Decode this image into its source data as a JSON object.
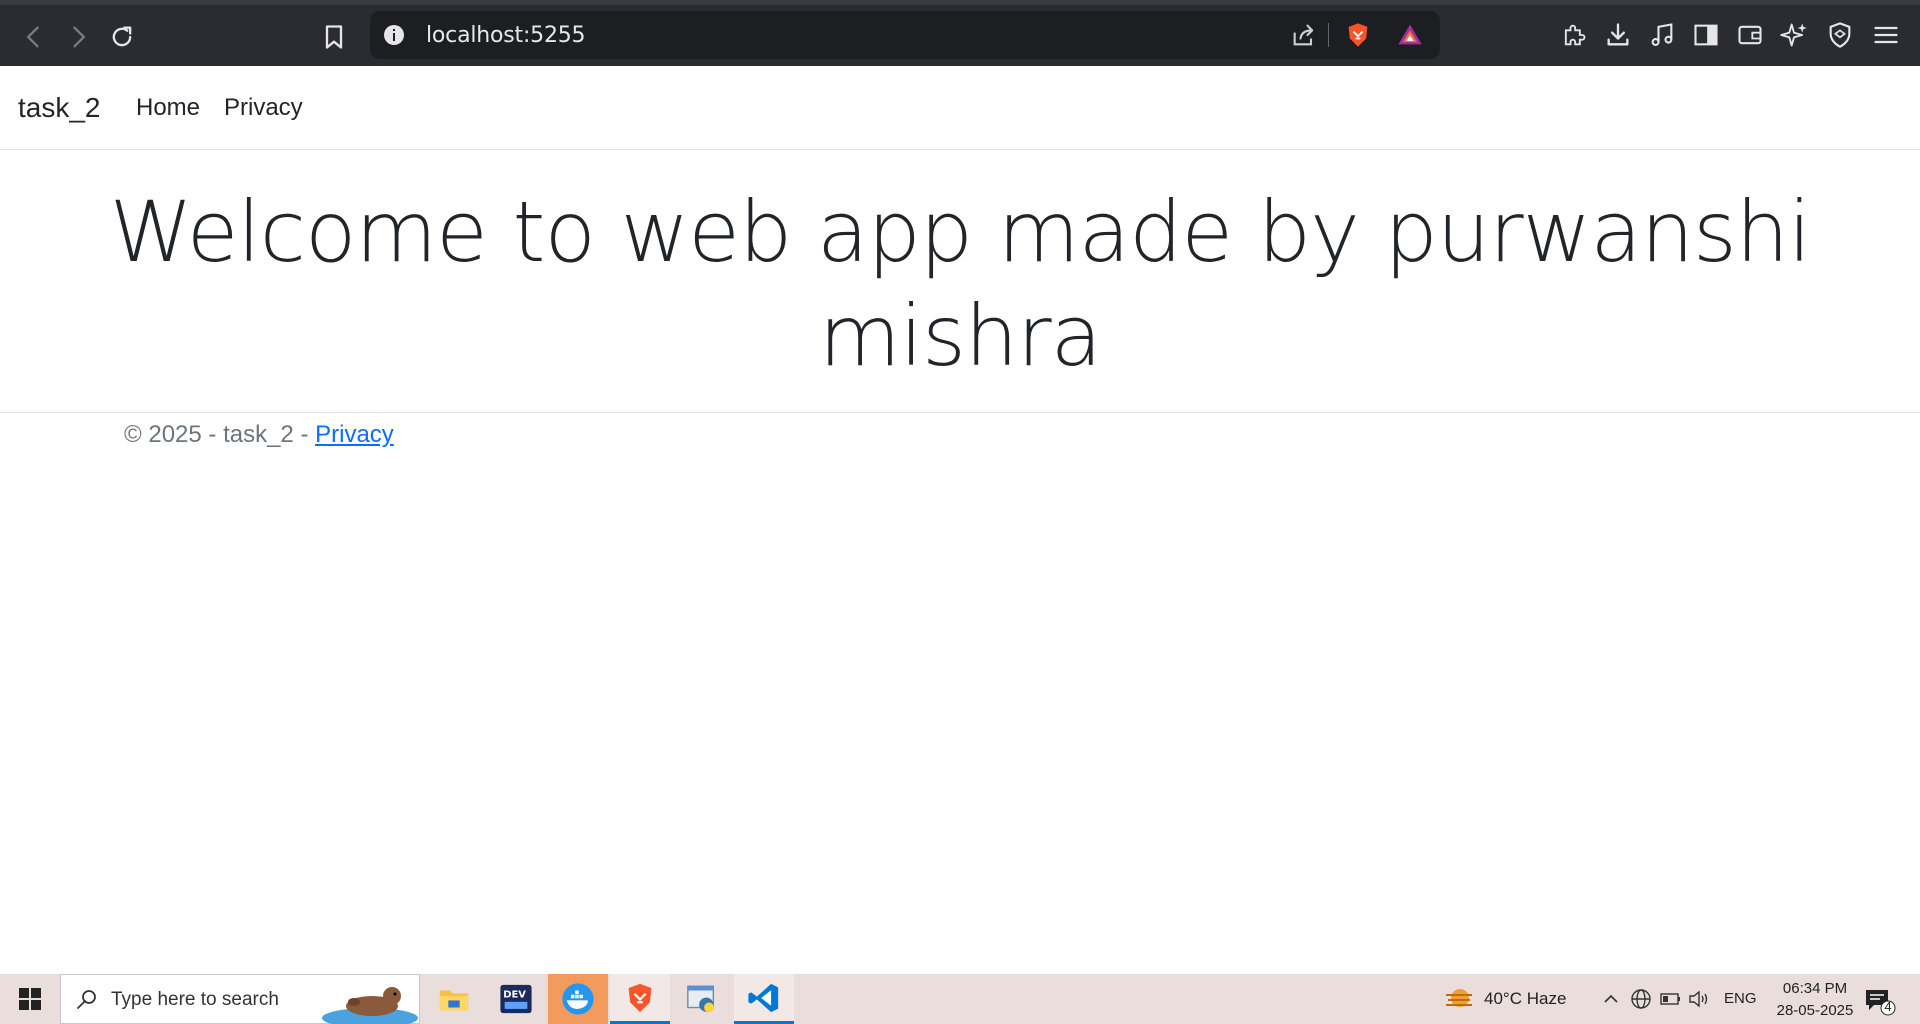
{
  "browser": {
    "address_url": "localhost:5255"
  },
  "site": {
    "brand": "task_2",
    "nav": [
      {
        "label": "Home"
      },
      {
        "label": "Privacy"
      }
    ],
    "welcome_line1": "Welcome to web app made by purwanshi",
    "welcome_line2": "mishra",
    "footer_prefix": "© 2025 - task_2 - ",
    "footer_link": "Privacy"
  },
  "taskbar": {
    "search_placeholder": "Type here to search",
    "weather": "40°C  Haze",
    "language": "ENG",
    "time": "06:34 PM",
    "date": "28-05-2025",
    "notification_count": "4"
  },
  "colors": {
    "browser_bg": "#2b2c31",
    "link": "#0d6efd",
    "taskbar_bg": "#e9dedc",
    "vscode": "#0078d4",
    "brave": "#fb542b"
  }
}
